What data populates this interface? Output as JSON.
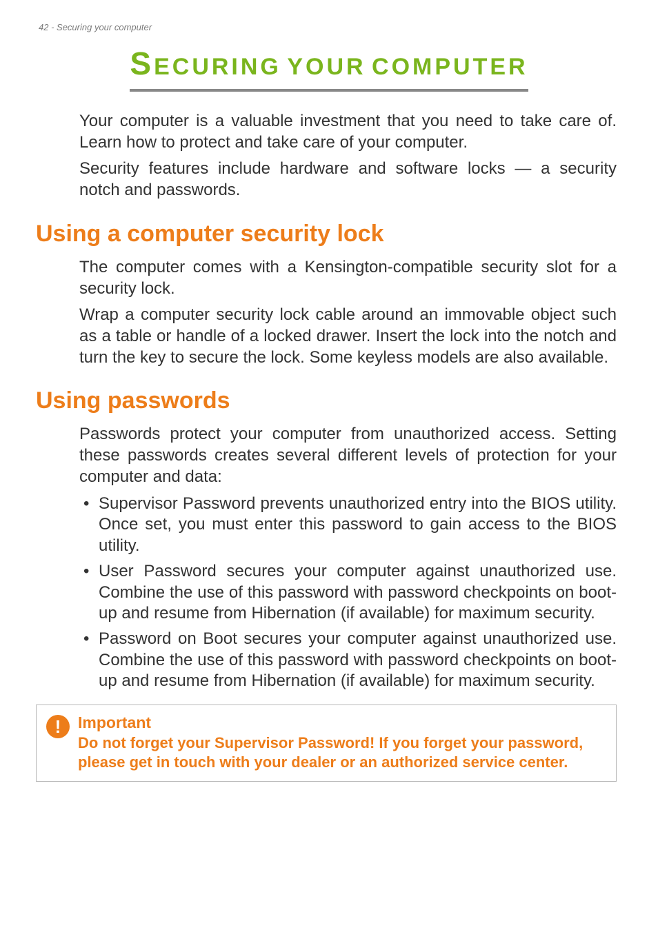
{
  "header": {
    "page_number": "42",
    "section_name": "Securing your computer"
  },
  "title": {
    "cap1": "S",
    "word1": "ECURING",
    "word2": "YOUR",
    "word3": "COMPUTER"
  },
  "intro": {
    "p1": "Your computer is a valuable investment that you need to take care of. Learn how to protect and take care of your computer.",
    "p2": "Security features include hardware and software locks — a security notch and passwords."
  },
  "section1": {
    "heading": "Using a computer security lock",
    "p1": "The computer comes with a Kensington-compatible security slot for a security lock.",
    "p2": "Wrap a computer security lock cable around an immovable object such as a table or handle of a locked drawer. Insert the lock into the notch and turn the key to secure the lock. Some keyless models are also available."
  },
  "section2": {
    "heading": "Using passwords",
    "p1": "Passwords protect your computer from unauthorized access. Setting these passwords creates several different levels of protection for your computer and data:",
    "bullets": [
      "Supervisor Password prevents unauthorized entry into the BIOS utility. Once set, you must enter this password to gain access to the BIOS utility.",
      "User Password secures your computer against unauthorized use. Combine the use of this password with password checkpoints on boot-up and resume from Hibernation (if available) for maximum security.",
      "Password on Boot secures your computer against unauthorized use. Combine the use of this password with password checkpoints on boot-up and resume from Hibernation (if available) for maximum security."
    ]
  },
  "callout": {
    "icon_glyph": "!",
    "title": "Important",
    "body": "Do not forget your Supervisor Password! If you forget your password, please get in touch with your dealer or an authorized service center."
  }
}
